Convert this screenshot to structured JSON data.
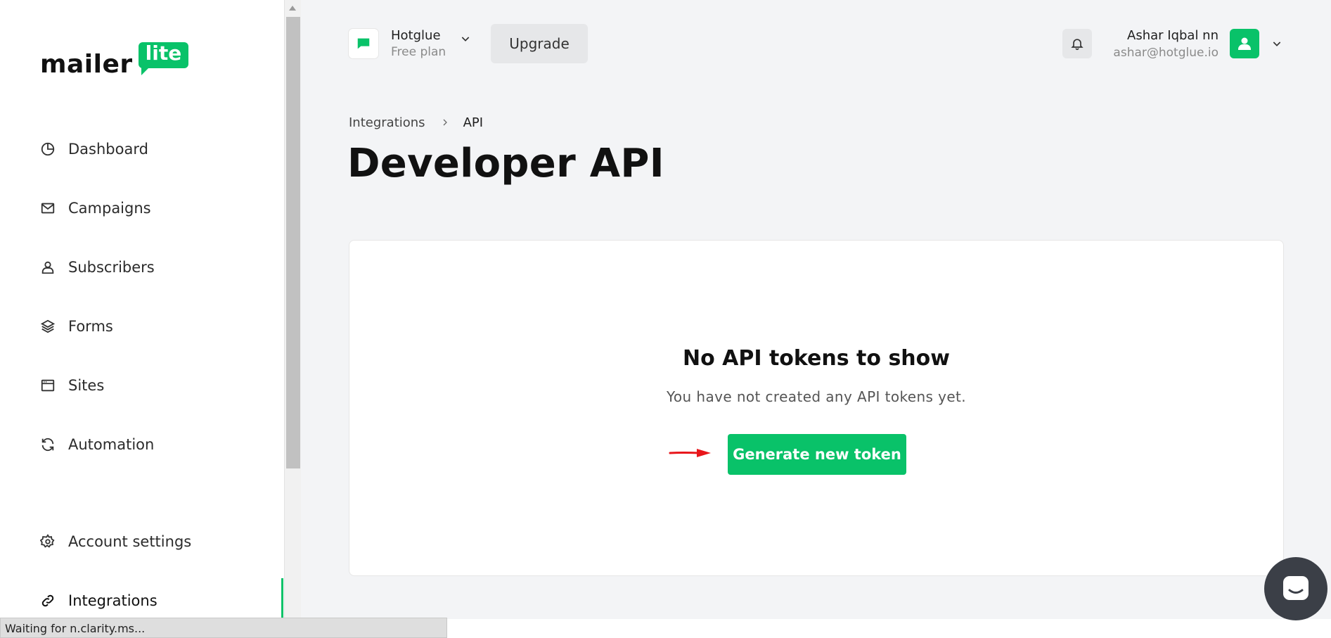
{
  "brand": {
    "word": "mailer",
    "badge": "lite",
    "accent": "#09c269"
  },
  "sidebar": {
    "items": [
      {
        "label": "Dashboard",
        "icon": "chart-pie-icon"
      },
      {
        "label": "Campaigns",
        "icon": "envelope-icon"
      },
      {
        "label": "Subscribers",
        "icon": "user-icon"
      },
      {
        "label": "Forms",
        "icon": "layers-icon"
      },
      {
        "label": "Sites",
        "icon": "browser-window-icon"
      },
      {
        "label": "Automation",
        "icon": "refresh-icon"
      },
      {
        "label": "Account settings",
        "icon": "gear-icon"
      },
      {
        "label": "Integrations",
        "icon": "link-icon",
        "active": true
      }
    ]
  },
  "header": {
    "account_name": "Hotglue",
    "account_plan": "Free plan",
    "upgrade_label": "Upgrade",
    "user_name": "Ashar Iqbal nn",
    "user_email": "ashar@hotglue.io"
  },
  "breadcrumb": {
    "parent": "Integrations",
    "current": "API"
  },
  "page": {
    "title": "Developer API"
  },
  "empty_state": {
    "title": "No API tokens to show",
    "subtitle": "You have not created any API tokens yet.",
    "button_label": "Generate new token"
  },
  "status_bar": {
    "text": "Waiting for n.clarity.ms..."
  }
}
